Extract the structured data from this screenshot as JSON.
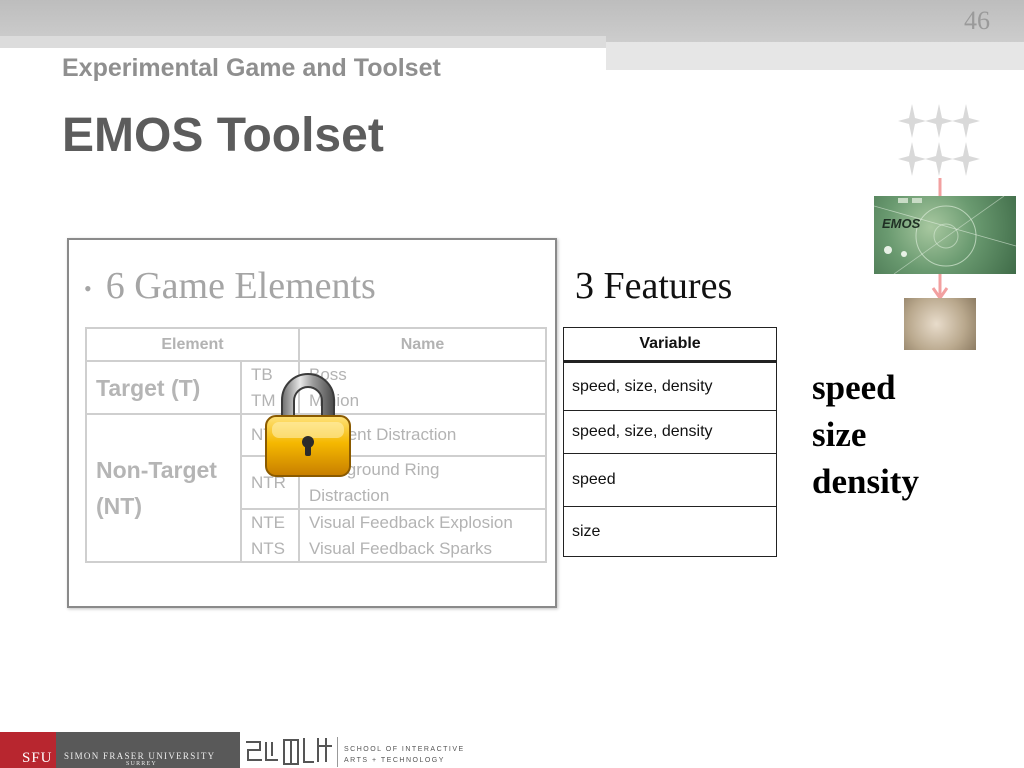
{
  "slide": {
    "number": "46",
    "section_title": "Experimental Game and Toolset",
    "title": "EMOS Toolset"
  },
  "left_panel": {
    "bullet": "6 Game Elements",
    "table": {
      "headers": [
        "Element",
        "Name"
      ],
      "rows": [
        {
          "group": "Target (T)",
          "codes": [
            "TB",
            "TM"
          ],
          "names": [
            "Boss",
            "Minion"
          ]
        },
        {
          "group": "Non-Target (NT)",
          "codes": [
            "NT"
          ],
          "names": [
            "Ambient Distraction"
          ]
        },
        {
          "group": "",
          "codes": [
            "NTR"
          ],
          "names": [
            "Background Ring",
            "Distraction"
          ]
        },
        {
          "group": "",
          "codes": [
            "NTE",
            "NTS"
          ],
          "names": [
            "Visual Feedback Explosion",
            "Visual Feedback Sparks"
          ]
        }
      ]
    },
    "overlay_icon": "lock-icon"
  },
  "features": {
    "heading": "3 Features",
    "table_header": "Variable",
    "rows": [
      "speed, size, density",
      "speed, size, density",
      "speed",
      "size"
    ],
    "list": [
      "speed",
      "size",
      "density"
    ]
  },
  "thumbnails": {
    "emos_label": "EMOS"
  },
  "footer": {
    "sfu": "SFU",
    "university": "SIMON FRASER UNIVERSITY",
    "campus": "SURREY",
    "school_line1": "SCHOOL OF INTERACTIVE",
    "school_line2": "ARTS + TECHNOLOGY"
  },
  "colors": {
    "arrow": "#f2a0a0",
    "sfu_red": "#b8262f"
  }
}
